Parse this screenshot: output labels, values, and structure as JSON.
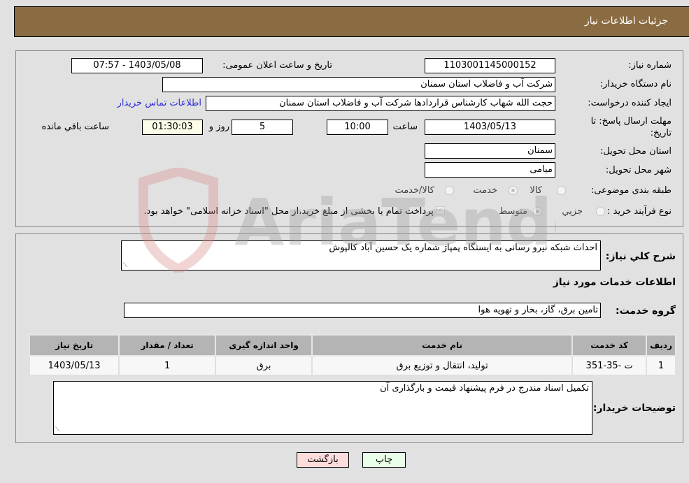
{
  "header": {
    "title": "جزئیات اطلاعات نیاز"
  },
  "details": {
    "need_number": {
      "label": "شماره نیاز:",
      "value": "1103001145000152"
    },
    "announce_datetime": {
      "label": "تاریخ و ساعت اعلان عمومی:",
      "value": "1403/05/08 - 07:57"
    },
    "buyer_org": {
      "label": "نام دستگاه خریدار:",
      "value": "شرکت آب و فاضلاب استان سمنان"
    },
    "requester": {
      "label": "ایجاد کننده درخواست:",
      "value": "حجت الله شهاب کارشناس قراردادها شرکت آب و فاضلاب استان سمنان"
    },
    "contact_link": "اطلاعات تماس خریدار",
    "deadline": {
      "label": "مهلت ارسال پاسخ: تا تاریخ:",
      "date": "1403/05/13",
      "time_label": "ساعت",
      "time": "10:00",
      "days": "5",
      "days_label": "روز و",
      "remaining": "01:30:03",
      "remaining_label": "ساعت باقي مانده"
    },
    "province": {
      "label": "استان محل تحویل:",
      "value": "سمنان"
    },
    "city": {
      "label": "شهر محل تحویل:",
      "value": "میامی"
    },
    "category": {
      "label": "طبقه بندی موضوعی:",
      "options": [
        "کالا",
        "خدمت",
        "کالا/خدمت"
      ],
      "selected": "خدمت"
    },
    "purchase_type": {
      "label": "نوع فرآیند خرید :",
      "options": [
        "جزيي",
        "متوسط"
      ],
      "selected": "متوسط",
      "treasury_note": "پرداخت تمام یا بخشی از مبلغ خرید،از محل \"اسناد خزانه اسلامی\" خواهد بود.",
      "treasury_checked": true
    }
  },
  "services": {
    "description_label": "شرح کلي نیاز:",
    "description": "احداث شبکه نیرو رسانی به ایستگاه پمپاژ شماره یک حسین آباد کالپوش",
    "section_title": "اطلاعات خدمات مورد نیاز",
    "group_label": "گروه خدمت:",
    "group_value": "تامین برق، گاز، بخار و تهویه هوا",
    "table": {
      "headers": [
        "ردیف",
        "کد خدمت",
        "نام خدمت",
        "واحد اندازه گیری",
        "تعداد / مقدار",
        "تاریخ نیاز"
      ],
      "rows": [
        [
          "1",
          "ت -35-351",
          "تولید، انتقال و توزیع برق",
          "برق",
          "1",
          "1403/05/13"
        ]
      ]
    },
    "buyer_notes_label": "توضیحات خریدار:",
    "buyer_notes": "تکمیل اسناد مندرج در فرم پیشنهاد قیمت و بارگذاری آن"
  },
  "buttons": {
    "print": "چاپ",
    "back": "بازگشت"
  },
  "watermark": "AriaTender.neT",
  "colors": {
    "header_bg": "#8b6c42",
    "back_bg": "#fddcdc",
    "print_bg": "#eaffea",
    "link": "#2b2bd6"
  }
}
